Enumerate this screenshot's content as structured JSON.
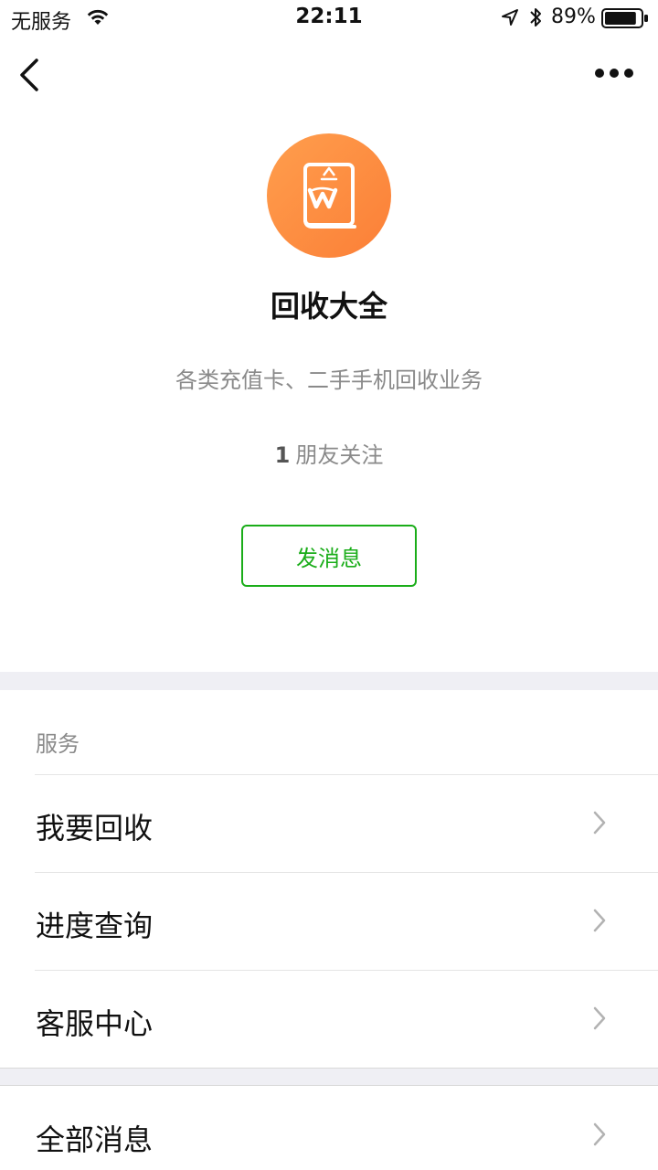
{
  "status_bar": {
    "carrier": "无服务",
    "time": "22:11",
    "battery_percent": "89%",
    "battery_level": 0.89
  },
  "nav": {
    "back_icon": "chevron-left-icon",
    "more_icon": "more-dots-icon"
  },
  "profile": {
    "avatar_icon": "recycle-book-icon",
    "name": "回收大全",
    "description": "各类充值卡、二手手机回收业务",
    "followers_count": "1",
    "followers_label": "朋友关注",
    "message_button_label": "发消息"
  },
  "services": {
    "title": "服务",
    "items": [
      {
        "label": "我要回收"
      },
      {
        "label": "进度查询"
      },
      {
        "label": "客服中心"
      }
    ]
  },
  "all_messages": {
    "label": "全部消息"
  },
  "colors": {
    "accent_green": "#1aad19",
    "avatar_orange": "#fb7f37",
    "muted_text": "#8a8a8a",
    "separator_bg": "#efeff4"
  }
}
